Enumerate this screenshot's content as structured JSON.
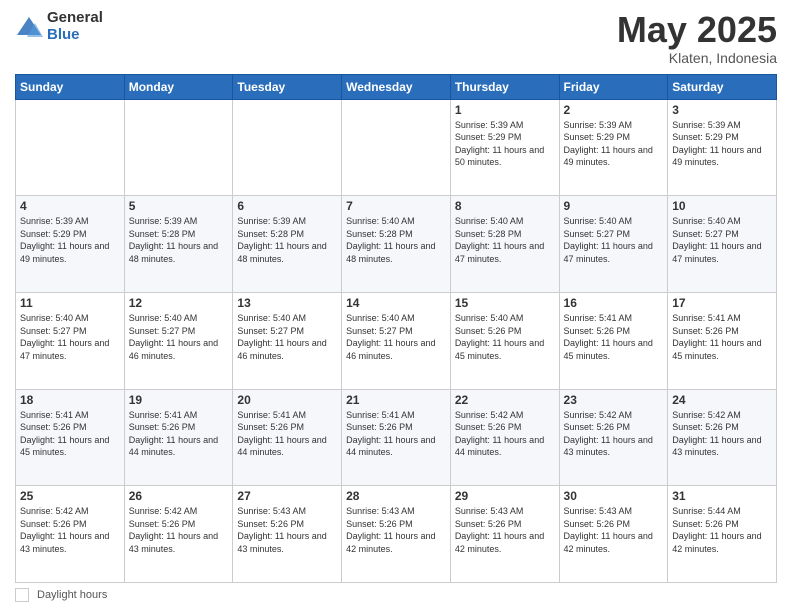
{
  "header": {
    "logo_general": "General",
    "logo_blue": "Blue",
    "title": "May 2025",
    "location": "Klaten, Indonesia"
  },
  "calendar": {
    "days_of_week": [
      "Sunday",
      "Monday",
      "Tuesday",
      "Wednesday",
      "Thursday",
      "Friday",
      "Saturday"
    ],
    "weeks": [
      [
        {
          "day": "",
          "info": ""
        },
        {
          "day": "",
          "info": ""
        },
        {
          "day": "",
          "info": ""
        },
        {
          "day": "",
          "info": ""
        },
        {
          "day": "1",
          "info": "Sunrise: 5:39 AM\nSunset: 5:29 PM\nDaylight: 11 hours\nand 50 minutes."
        },
        {
          "day": "2",
          "info": "Sunrise: 5:39 AM\nSunset: 5:29 PM\nDaylight: 11 hours\nand 49 minutes."
        },
        {
          "day": "3",
          "info": "Sunrise: 5:39 AM\nSunset: 5:29 PM\nDaylight: 11 hours\nand 49 minutes."
        }
      ],
      [
        {
          "day": "4",
          "info": "Sunrise: 5:39 AM\nSunset: 5:29 PM\nDaylight: 11 hours\nand 49 minutes."
        },
        {
          "day": "5",
          "info": "Sunrise: 5:39 AM\nSunset: 5:28 PM\nDaylight: 11 hours\nand 48 minutes."
        },
        {
          "day": "6",
          "info": "Sunrise: 5:39 AM\nSunset: 5:28 PM\nDaylight: 11 hours\nand 48 minutes."
        },
        {
          "day": "7",
          "info": "Sunrise: 5:40 AM\nSunset: 5:28 PM\nDaylight: 11 hours\nand 48 minutes."
        },
        {
          "day": "8",
          "info": "Sunrise: 5:40 AM\nSunset: 5:28 PM\nDaylight: 11 hours\nand 47 minutes."
        },
        {
          "day": "9",
          "info": "Sunrise: 5:40 AM\nSunset: 5:27 PM\nDaylight: 11 hours\nand 47 minutes."
        },
        {
          "day": "10",
          "info": "Sunrise: 5:40 AM\nSunset: 5:27 PM\nDaylight: 11 hours\nand 47 minutes."
        }
      ],
      [
        {
          "day": "11",
          "info": "Sunrise: 5:40 AM\nSunset: 5:27 PM\nDaylight: 11 hours\nand 47 minutes."
        },
        {
          "day": "12",
          "info": "Sunrise: 5:40 AM\nSunset: 5:27 PM\nDaylight: 11 hours\nand 46 minutes."
        },
        {
          "day": "13",
          "info": "Sunrise: 5:40 AM\nSunset: 5:27 PM\nDaylight: 11 hours\nand 46 minutes."
        },
        {
          "day": "14",
          "info": "Sunrise: 5:40 AM\nSunset: 5:27 PM\nDaylight: 11 hours\nand 46 minutes."
        },
        {
          "day": "15",
          "info": "Sunrise: 5:40 AM\nSunset: 5:26 PM\nDaylight: 11 hours\nand 45 minutes."
        },
        {
          "day": "16",
          "info": "Sunrise: 5:41 AM\nSunset: 5:26 PM\nDaylight: 11 hours\nand 45 minutes."
        },
        {
          "day": "17",
          "info": "Sunrise: 5:41 AM\nSunset: 5:26 PM\nDaylight: 11 hours\nand 45 minutes."
        }
      ],
      [
        {
          "day": "18",
          "info": "Sunrise: 5:41 AM\nSunset: 5:26 PM\nDaylight: 11 hours\nand 45 minutes."
        },
        {
          "day": "19",
          "info": "Sunrise: 5:41 AM\nSunset: 5:26 PM\nDaylight: 11 hours\nand 44 minutes."
        },
        {
          "day": "20",
          "info": "Sunrise: 5:41 AM\nSunset: 5:26 PM\nDaylight: 11 hours\nand 44 minutes."
        },
        {
          "day": "21",
          "info": "Sunrise: 5:41 AM\nSunset: 5:26 PM\nDaylight: 11 hours\nand 44 minutes."
        },
        {
          "day": "22",
          "info": "Sunrise: 5:42 AM\nSunset: 5:26 PM\nDaylight: 11 hours\nand 44 minutes."
        },
        {
          "day": "23",
          "info": "Sunrise: 5:42 AM\nSunset: 5:26 PM\nDaylight: 11 hours\nand 43 minutes."
        },
        {
          "day": "24",
          "info": "Sunrise: 5:42 AM\nSunset: 5:26 PM\nDaylight: 11 hours\nand 43 minutes."
        }
      ],
      [
        {
          "day": "25",
          "info": "Sunrise: 5:42 AM\nSunset: 5:26 PM\nDaylight: 11 hours\nand 43 minutes."
        },
        {
          "day": "26",
          "info": "Sunrise: 5:42 AM\nSunset: 5:26 PM\nDaylight: 11 hours\nand 43 minutes."
        },
        {
          "day": "27",
          "info": "Sunrise: 5:43 AM\nSunset: 5:26 PM\nDaylight: 11 hours\nand 43 minutes."
        },
        {
          "day": "28",
          "info": "Sunrise: 5:43 AM\nSunset: 5:26 PM\nDaylight: 11 hours\nand 42 minutes."
        },
        {
          "day": "29",
          "info": "Sunrise: 5:43 AM\nSunset: 5:26 PM\nDaylight: 11 hours\nand 42 minutes."
        },
        {
          "day": "30",
          "info": "Sunrise: 5:43 AM\nSunset: 5:26 PM\nDaylight: 11 hours\nand 42 minutes."
        },
        {
          "day": "31",
          "info": "Sunrise: 5:44 AM\nSunset: 5:26 PM\nDaylight: 11 hours\nand 42 minutes."
        }
      ]
    ]
  },
  "footer": {
    "daylight_label": "Daylight hours"
  }
}
